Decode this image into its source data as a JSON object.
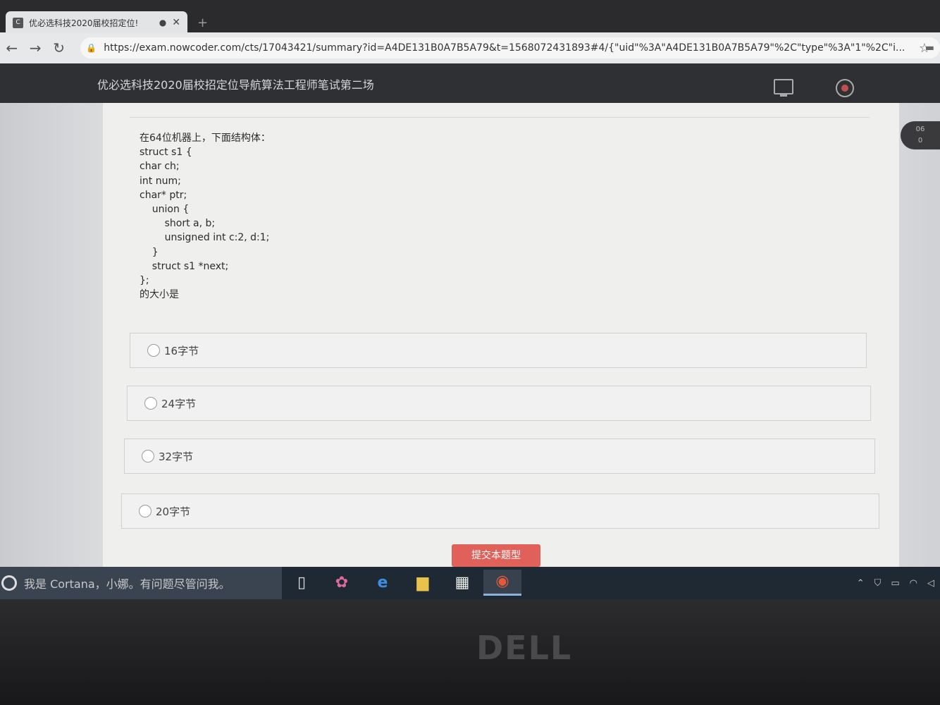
{
  "browser": {
    "tab_title": "优必选科技2020届校招定位!",
    "favicon_text": "C",
    "new_tab": "+",
    "url": "https://exam.nowcoder.com/cts/17043421/summary?id=A4DE131B0A7B5A79&t=1568072431893#4/{\"uid\"%3A\"A4DE131B0A7B5A79\"%2C\"type\"%3A\"1\"%2C\"i...",
    "back_icon": "arrow-left-icon",
    "forward_icon": "arrow-right-icon",
    "reload_icon": "reload-icon"
  },
  "header": {
    "exam_title": "优必选科技2020届校招定位导航算法工程师笔试第二场"
  },
  "question": {
    "text": "在64位机器上，下面结构体：\nstruct s1 {\nchar ch;\nint num;\nchar* ptr;\n    union {\n        short a, b;\n        unsigned int c:2, d:1;\n    }\n    struct s1 *next;\n};\n的大小是"
  },
  "options": [
    {
      "label": "16字节"
    },
    {
      "label": "24字节"
    },
    {
      "label": "32字节"
    },
    {
      "label": "20字节"
    }
  ],
  "submit_label": "提交本题型",
  "timer": {
    "line1": "06",
    "line2": "0"
  },
  "taskbar": {
    "cortana_text": "我是 Cortana，小娜。有问题尽管问我。"
  },
  "brand": "DELL"
}
